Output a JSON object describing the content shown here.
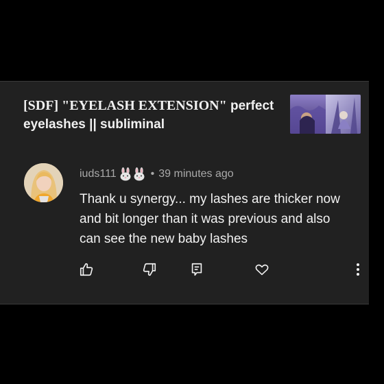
{
  "video": {
    "title_part1": "[SDF] \"EYELASH EXTENSION\"",
    "title_part2": " perfect eyelashes || subliminal"
  },
  "comment": {
    "username": "iuds111",
    "emoji_icon_name": "rabbit-face-icon",
    "separator": "•",
    "time_ago": "39 minutes ago",
    "text": "Thank u synergy... my lashes are thicker now and bit longer than it was previous and also can see the new baby lashes"
  },
  "actions": {
    "like_icon": "thumbs-up-icon",
    "dislike_icon": "thumbs-down-icon",
    "reply_icon": "reply-icon",
    "heart_icon": "heart-icon",
    "more_icon": "more-vert-icon"
  },
  "colors": {
    "background": "#000000",
    "card": "#212121",
    "text_primary": "#f1f1f1",
    "text_secondary": "#aaaaaa"
  }
}
